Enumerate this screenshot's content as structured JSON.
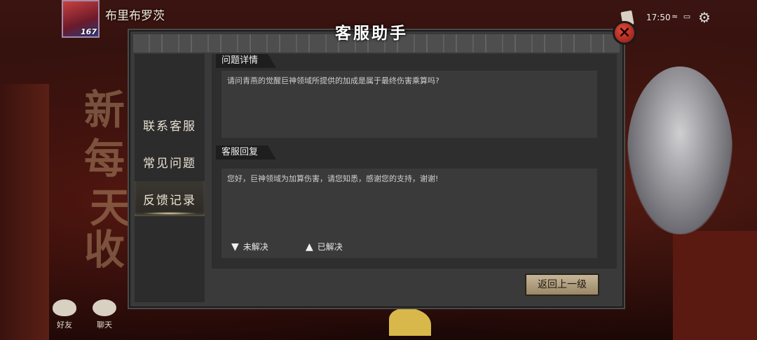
{
  "player": {
    "name": "布里布罗茨",
    "level": "167"
  },
  "status": {
    "time": "17:50",
    "icons": "≈ ▭"
  },
  "dialog": {
    "title": "客服助手",
    "close_icon": "×",
    "sidebar": [
      {
        "label": "联系客服",
        "active": false
      },
      {
        "label": "常见问题",
        "active": false
      },
      {
        "label": "反馈记录",
        "active": true
      }
    ],
    "question": {
      "label": "问题详情",
      "text": "请问青燕的觉醒巨神领域所提供的加成是属于最终伤害乘算吗?"
    },
    "reply": {
      "label": "客服回复",
      "text": "您好，巨神领域为加算伤害，请您知悉，感谢您的支持，谢谢!"
    },
    "unresolved_label": "未解决",
    "resolved_label": "已解决",
    "back_label": "返回上一级"
  },
  "background_text": [
    "新",
    "每",
    "天",
    "收"
  ],
  "bottom_bar": {
    "friends": "好友",
    "chat": "聊天"
  }
}
